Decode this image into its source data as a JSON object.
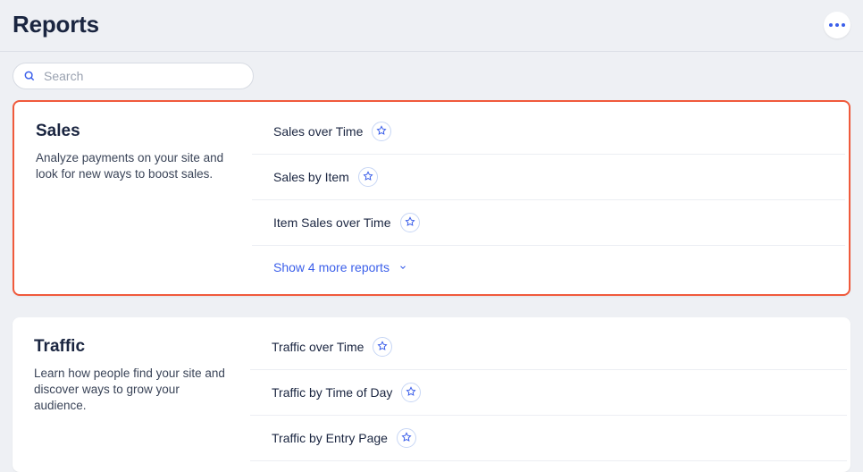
{
  "header": {
    "title": "Reports"
  },
  "search": {
    "placeholder": "Search"
  },
  "sections": [
    {
      "title": "Sales",
      "description": "Analyze payments on your site and look for new ways to boost sales.",
      "highlighted": true,
      "reports": [
        {
          "name": "Sales over Time"
        },
        {
          "name": "Sales by Item"
        },
        {
          "name": "Item Sales over Time"
        }
      ],
      "show_more_label": "Show 4 more reports"
    },
    {
      "title": "Traffic",
      "description": "Learn how people find your site and discover ways to grow your audience.",
      "highlighted": false,
      "reports": [
        {
          "name": "Traffic over Time"
        },
        {
          "name": "Traffic by Time of Day"
        },
        {
          "name": "Traffic by Entry Page"
        }
      ],
      "show_more_label": ""
    }
  ]
}
